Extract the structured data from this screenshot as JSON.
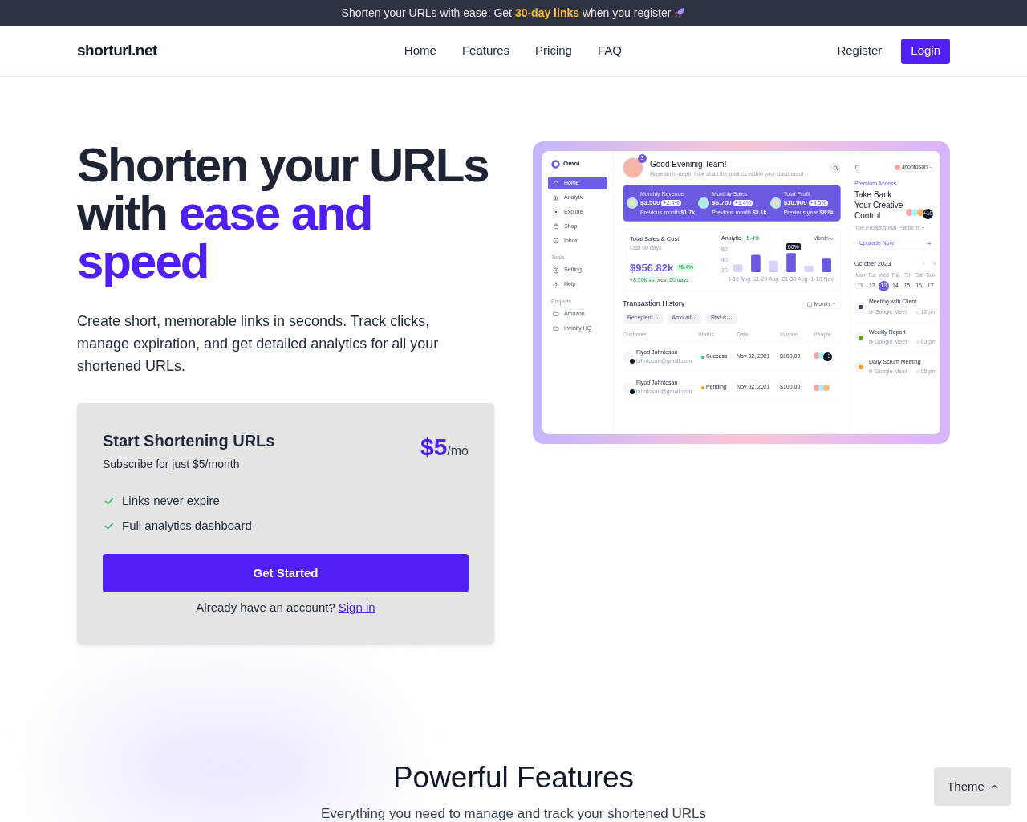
{
  "announcement": {
    "text": "Shorten your URLs with ease: Get **30-day links** when you register"
  },
  "nav": {
    "logo": "shorturl.net",
    "links": [
      {
        "label": "Home"
      },
      {
        "label": "Features"
      },
      {
        "label": "Pricing"
      },
      {
        "label": "FAQ"
      }
    ],
    "register": "Register",
    "login": "Login"
  },
  "hero": {
    "title": "Shorten your URLs with **ease and speed**",
    "description": "Create short, memorable links in seconds. Track clicks, manage expiration, and get detailed analytics for all your shortened URLs."
  },
  "pricing": {
    "title": "Start Shortening URLs",
    "subtitle": "Subscribe for just $5/month",
    "price": "$5",
    "period": "/mo",
    "features": [
      "Links never expire",
      "Full analytics dashboard"
    ],
    "button": "Get Started",
    "signin_prompt": "Already have an account?",
    "signin_link": "Sign in"
  },
  "dashboard": {
    "brand": "Omoi",
    "menu": [
      {
        "label": "Home",
        "selected": true
      },
      {
        "label": "Analytic",
        "selected": false
      },
      {
        "label": "Explore",
        "selected": false
      },
      {
        "label": "Shop",
        "selected": false
      },
      {
        "label": "Inbox",
        "selected": false
      }
    ],
    "tools_heading": "Tools",
    "tools": [
      {
        "label": "Setting"
      },
      {
        "label": "Help"
      }
    ],
    "projects_heading": "Projects",
    "projects": [
      {
        "label": "Amazon"
      },
      {
        "label": "Invinity HQ"
      }
    ],
    "greeting": "Good Eveninig Team!",
    "greeting_sub": "Have an in-depth look at all the metrics within your dashboard",
    "notification_count": "3",
    "stats": [
      {
        "label": "Monthly Revenue",
        "value": "$3.500",
        "change": "+2.4%",
        "note": "Previous month **$1.7k**"
      },
      {
        "label": "Monthly Sales",
        "value": "$6.750",
        "change": "+1.4%",
        "note": "Previous month **$3.1k**"
      },
      {
        "label": "Total Profit",
        "value": "$10.900",
        "change": "+4.5%",
        "note": "Previous year **$8.9k**"
      }
    ],
    "sales": {
      "title": "Total Sales & Cost",
      "period": "Last 60 days",
      "amount": "$956.82k",
      "change": "+5.4%",
      "compare": "+8.20k vs prev. 60 days"
    },
    "analytic": {
      "title": "Analytic",
      "change": "+5.4%",
      "dropdown": "Month",
      "tooltip": "60%",
      "yticks": [
        "80",
        "40",
        "20"
      ],
      "xlabels": [
        "1-10 Aug",
        "11-20 Aug",
        "21-30 Aug",
        "1-10 Nov"
      ]
    },
    "transactions": {
      "title": "Transastion History",
      "period": "Month",
      "filters": [
        "Recepient",
        "Amount",
        "Status"
      ],
      "columns": [
        "Customer",
        "Status",
        "Date",
        "Invoice",
        "People"
      ],
      "rows": [
        {
          "name": "Flyod Johntosan",
          "email": "johntosan@gmail.com",
          "status": "Success",
          "color": "#22c55e",
          "date": "Nov 02, 2021",
          "invoice": "$100,00",
          "people_extra": "+3"
        },
        {
          "name": "Flyod Johntosan",
          "email": "johntosan@gmail.com",
          "status": "Pending",
          "color": "#f59e0b",
          "date": "Nov 02, 2021",
          "invoice": "$100,00"
        }
      ]
    },
    "user": "Jhontosan",
    "premium": "Premium Access",
    "promo_title": "Take Back Your Creative Control",
    "promo_extra": "+10",
    "platform": "The Professional Platform",
    "upgrade": "Upgrade Now",
    "calendar": {
      "month": "October 2023",
      "weekdays": [
        "Mon",
        "Tue",
        "Wed",
        "Thu",
        "Fri",
        "Sat",
        "Sun"
      ],
      "days": [
        {
          "label": "11",
          "selected": false
        },
        {
          "label": "12",
          "selected": false
        },
        {
          "label": "13",
          "selected": true
        },
        {
          "label": "14",
          "selected": false
        },
        {
          "label": "15",
          "selected": false
        },
        {
          "label": "16",
          "selected": false
        },
        {
          "label": "17",
          "selected": false
        }
      ]
    },
    "events": [
      {
        "title": "Meeting with Client",
        "place": "Google Meet",
        "time": "12 pm"
      },
      {
        "title": "Weekly Report",
        "place": "Google Meet",
        "time": "03 pm"
      },
      {
        "title": "Daily Scrum Meeting",
        "place": "Google Meet",
        "time": "05 pm"
      }
    ]
  },
  "features": {
    "title": "Powerful Features",
    "subtitle": "Everything you need to manage and track your shortened URLs"
  },
  "theme_button": "Theme"
}
